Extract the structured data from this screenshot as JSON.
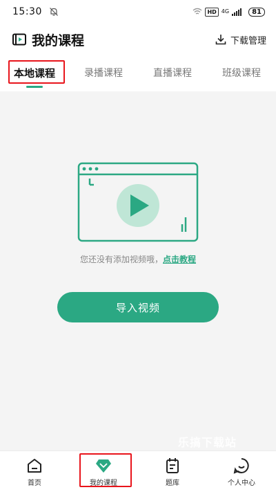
{
  "status_bar": {
    "time": "15:30",
    "hd": "HD",
    "network": "4G",
    "battery": "81"
  },
  "header": {
    "title": "我的课程",
    "download_label": "下载管理"
  },
  "tabs": [
    {
      "label": "本地课程",
      "active": true
    },
    {
      "label": "录播课程",
      "active": false
    },
    {
      "label": "直播课程",
      "active": false
    },
    {
      "label": "班级课程",
      "active": false
    }
  ],
  "empty_state": {
    "message": "您还没有添加视频哦，",
    "link": "点击教程"
  },
  "import_button": "导入视频",
  "watermark": "乐搞下载站",
  "bottom_nav": [
    {
      "label": "首页",
      "icon": "home-icon"
    },
    {
      "label": "我的课程",
      "icon": "diamond-icon"
    },
    {
      "label": "题库",
      "icon": "notebook-icon"
    },
    {
      "label": "个人中心",
      "icon": "smile-icon"
    }
  ],
  "colors": {
    "accent": "#2ba883",
    "highlight": "#e8141b",
    "background": "#f4f4f4"
  }
}
